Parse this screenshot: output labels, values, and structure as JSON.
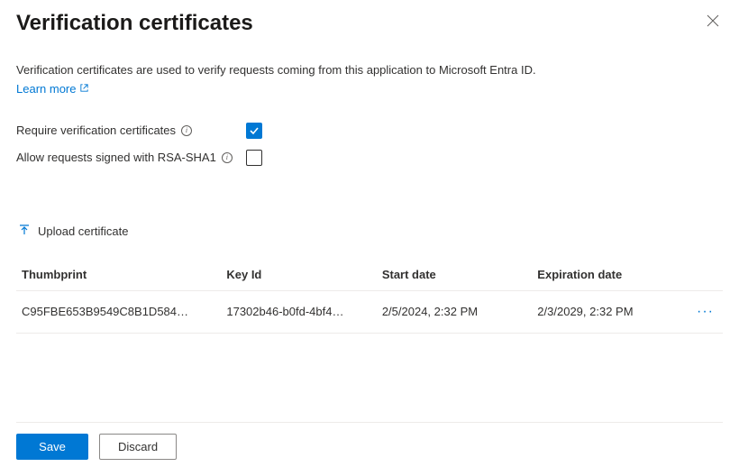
{
  "header": {
    "title": "Verification certificates",
    "description": "Verification certificates are used to verify requests coming from this application to Microsoft Entra ID.",
    "learn_more": "Learn more"
  },
  "settings": {
    "require_label": "Require verification certificates",
    "require_checked": true,
    "rsa_label": "Allow requests signed with RSA-SHA1",
    "rsa_checked": false
  },
  "upload": {
    "label": "Upload certificate"
  },
  "table": {
    "columns": {
      "thumbprint": "Thumbprint",
      "keyid": "Key Id",
      "start": "Start date",
      "expiration": "Expiration date"
    },
    "row": {
      "thumbprint": "C95FBE653B9549C8B1D584…",
      "keyid": "17302b46-b0fd-4bf4…",
      "start": "2/5/2024, 2:32 PM",
      "expiration": "2/3/2029, 2:32 PM"
    }
  },
  "footer": {
    "save": "Save",
    "discard": "Discard"
  }
}
